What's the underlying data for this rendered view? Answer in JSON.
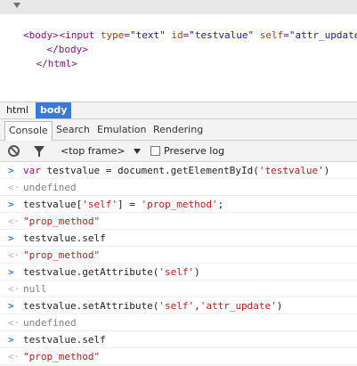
{
  "elements": {
    "body_open": "<body>",
    "input_tag": "input",
    "attr_type_name": "type",
    "attr_type_val": "\"text\"",
    "attr_id_name": "id",
    "attr_id_val": "\"testvalue\"",
    "attr_self_name": "self",
    "attr_self_val": "\"attr_update\"",
    "body_close": "</body>",
    "html_close": "</html>"
  },
  "breadcrumbs": [
    "html",
    "body"
  ],
  "tabs": [
    "Console",
    "Search",
    "Emulation",
    "Rendering"
  ],
  "toolbar": {
    "frame_label": "<top frame>",
    "preserve_label": "Preserve log"
  },
  "console": {
    "cmd1_kw": "var",
    "cmd1_a": " testvalue = document.getElementById(",
    "cmd1_str": "'testvalue'",
    "cmd1_b": ")",
    "res1": "undefined",
    "cmd2_a": "testvalue[",
    "cmd2_str1": "'self'",
    "cmd2_b": "] = ",
    "cmd2_str2": "'prop_method'",
    "cmd2_c": ";",
    "res2": "\"prop_method\"",
    "cmd3": "testvalue.self",
    "res3": "\"prop_method\"",
    "cmd4_a": "testvalue.getAttribute(",
    "cmd4_str": "'self'",
    "cmd4_b": ")",
    "res4": "null",
    "cmd5_a": "testvalue.setAttribute(",
    "cmd5_str1": "'self'",
    "cmd5_b": ",",
    "cmd5_str2": "'attr_update'",
    "cmd5_c": ")",
    "res5": "undefined",
    "cmd6": "testvalue.self",
    "res6": "\"prop_method\""
  },
  "colors": {
    "accent": "#3879d9",
    "prompt": "#367cf1",
    "string": "#c41a16",
    "keyword": "#aa0d91"
  }
}
